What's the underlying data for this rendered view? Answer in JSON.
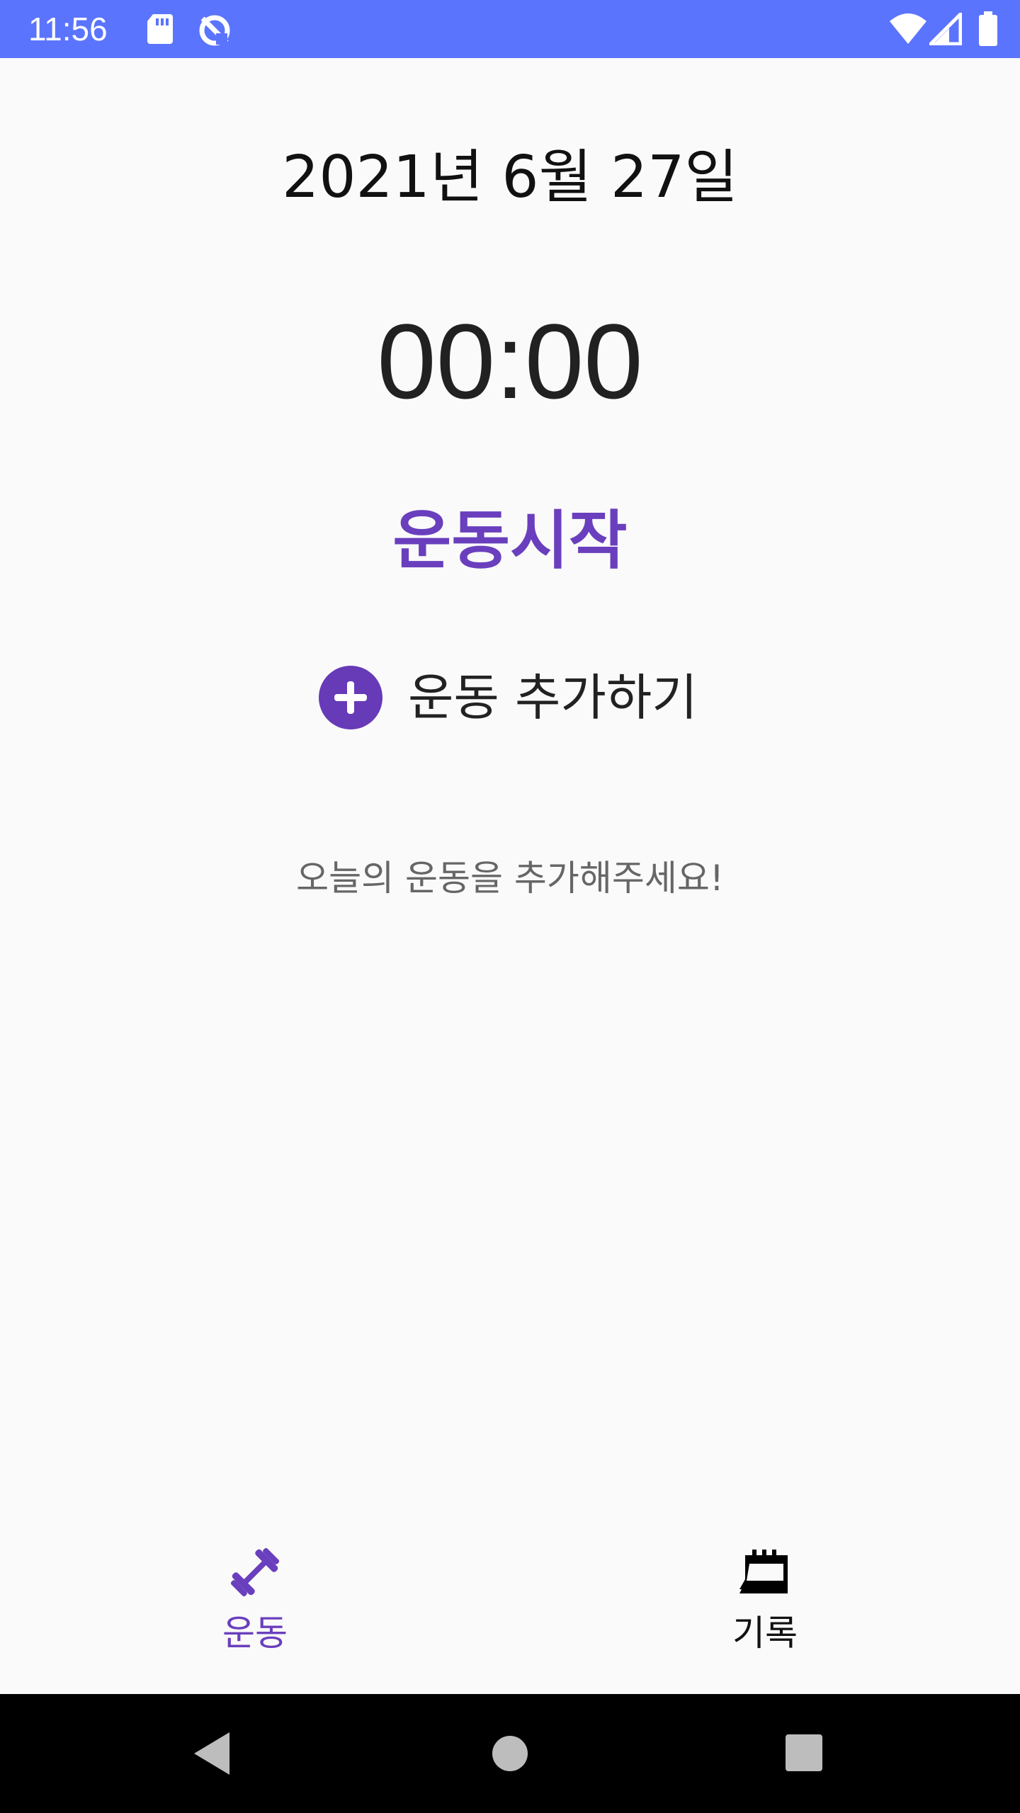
{
  "status_bar": {
    "time": "11:56",
    "icons": [
      "sd-card-icon",
      "sync-off-icon",
      "wifi-icon",
      "cell-signal-icon",
      "battery-icon"
    ],
    "background": "#5b74fd"
  },
  "main": {
    "date": "2021년 6월 27일",
    "timer": "00:00",
    "start_label": "운동시작",
    "add_label": "운동 추가하기",
    "empty_message": "오늘의 운동을 추가해주세요!"
  },
  "bottom_nav": {
    "items": [
      {
        "label": "운동",
        "icon": "dumbbell-icon",
        "selected": true
      },
      {
        "label": "기록",
        "icon": "notebook-icon",
        "selected": false
      }
    ]
  },
  "colors": {
    "accent": "#673ab7",
    "status_bar": "#5b74fd",
    "background": "#fafafa"
  }
}
